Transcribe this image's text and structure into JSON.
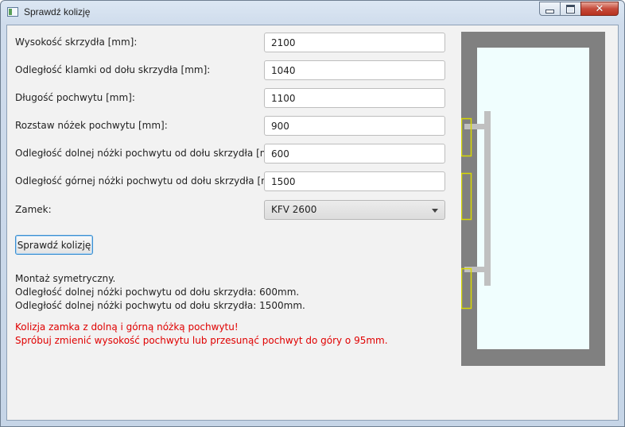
{
  "window": {
    "title": "Sprawdź kolizję",
    "controls": {
      "minimize": "—",
      "maximize": "□",
      "close": "✕"
    }
  },
  "form": {
    "rows": [
      {
        "label": "Wysokość skrzydła [mm]:",
        "value": "2100"
      },
      {
        "label": "Odległość klamki od dołu skrzydła [mm]:",
        "value": "1040"
      },
      {
        "label": "Długość pochwytu [mm]:",
        "value": "1100"
      },
      {
        "label": "Rozstaw nóżek pochwytu [mm]:",
        "value": "900"
      },
      {
        "label": "Odległość dolnej nóżki pochwytu od dołu skrzydła [mm]:",
        "value": "600"
      },
      {
        "label": "Odległość górnej nóżki pochwytu od dołu skrzydła [mm]:",
        "value": "1500"
      }
    ],
    "lock": {
      "label": "Zamek:",
      "selected": "KFV 2600"
    },
    "check_button": "Sprawdź kolizję"
  },
  "results": {
    "info": [
      "Montaż symetryczny.",
      "Odległość dolnej nóżki pochwytu od dołu skrzydła: 600mm.",
      "Odległość dolnej nóżki pochwytu od dołu skrzydła: 1500mm."
    ],
    "errors": [
      "Kolizja zamka z dolną i górną nóżką pochwytu!",
      "Spróbuj zmienić wysokość pochwytu lub przesunąć pochwyt do góry o 95mm."
    ]
  },
  "preview": {
    "colors": {
      "frame": "#808080",
      "glass": "#f0fefe",
      "handle": "#c0c0c0",
      "lock_outline": "#d8d800"
    }
  }
}
